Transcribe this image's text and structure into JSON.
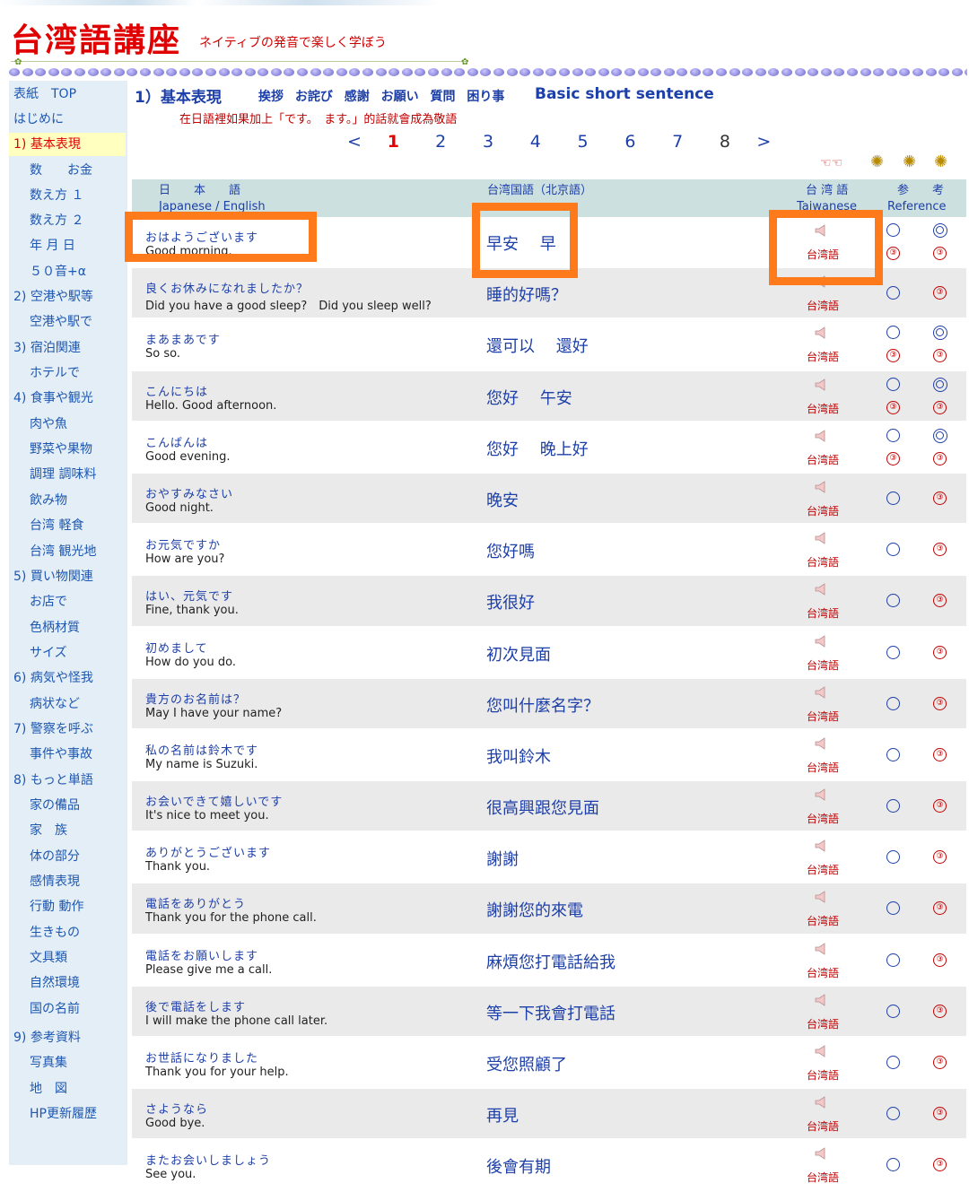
{
  "header": {
    "site_title": "台湾語講座",
    "subtitle": "ネイティブの発音で楽しく学ぼう"
  },
  "sidebar": {
    "items": [
      {
        "label": "表紙　TOP",
        "level": 0
      },
      {
        "label": "はじめに",
        "level": 0
      },
      {
        "label": "1) 基本表現",
        "level": 0,
        "active": true
      },
      {
        "label": "数　　お金",
        "level": 1
      },
      {
        "label": "数え方 １",
        "level": 1
      },
      {
        "label": "数え方 ２",
        "level": 1
      },
      {
        "label": "年 月 日",
        "level": 1
      },
      {
        "label": "５０音+α",
        "level": 1
      },
      {
        "label": "2) 空港や駅等",
        "level": 0
      },
      {
        "label": "空港や駅で",
        "level": 1
      },
      {
        "label": "3) 宿泊関連",
        "level": 0
      },
      {
        "label": "ホテルで",
        "level": 1
      },
      {
        "label": "4) 食事や観光",
        "level": 0
      },
      {
        "label": "肉や魚",
        "level": 1
      },
      {
        "label": "野菜や果物",
        "level": 1
      },
      {
        "label": "調理 調味料",
        "level": 1
      },
      {
        "label": "飲み物",
        "level": 1
      },
      {
        "label": "台湾 軽食",
        "level": 1
      },
      {
        "label": "台湾 観光地",
        "level": 1
      },
      {
        "label": "5) 買い物関連",
        "level": 0
      },
      {
        "label": "お店で",
        "level": 1
      },
      {
        "label": "色柄材質",
        "level": 1
      },
      {
        "label": "サイズ",
        "level": 1
      },
      {
        "label": "6) 病気や怪我",
        "level": 0
      },
      {
        "label": "病状など",
        "level": 1
      },
      {
        "label": "7) 警察を呼ぶ",
        "level": 0
      },
      {
        "label": "事件や事故",
        "level": 1
      },
      {
        "label": "8) もっと単語",
        "level": 0
      },
      {
        "label": "家の備品",
        "level": 1
      },
      {
        "label": "家　族",
        "level": 1
      },
      {
        "label": "体の部分",
        "level": 1
      },
      {
        "label": "感情表現",
        "level": 1
      },
      {
        "label": "行動 動作",
        "level": 1
      },
      {
        "label": "生きもの",
        "level": 1
      },
      {
        "label": "文具類",
        "level": 1
      },
      {
        "label": "自然環境",
        "level": 1
      },
      {
        "label": "国の名前",
        "level": 1
      },
      {
        "label": "9) 参考資料",
        "level": 0
      },
      {
        "label": "写真集",
        "level": 1
      },
      {
        "label": "地　図",
        "level": 1
      },
      {
        "label": "HP更新履歴",
        "level": 1
      }
    ]
  },
  "section": {
    "title": "1）基本表現",
    "tags": "挨拶 お詫び 感謝 お願い 質問 困り事",
    "english": "Basic short sentence",
    "note": "在日語裡如果加上「です。　ます。」的話就會成為敬語"
  },
  "pager": {
    "prev": "<",
    "pages": [
      "1",
      "2",
      "3",
      "4",
      "5",
      "6",
      "7",
      "8"
    ],
    "current": "1",
    "next": ">"
  },
  "table": {
    "headers": {
      "japanese": "日　　本　　語",
      "japanese_sub": "Japanese / English",
      "mandarin": "台湾国語（北京語）",
      "taiwanese": "台 湾 語",
      "taiwanese_sub": "Taiwanese",
      "reference": "参　　考",
      "reference_sub": "Reference"
    },
    "taiwanese_label": "台湾語",
    "ref_number": "③",
    "rows": [
      {
        "ja": "おはようございます",
        "en": "Good morning.",
        "tw": "早安　 早",
        "extra": true
      },
      {
        "ja": "良くお休みになれましたか？",
        "en": "Did you have a good sleep?　Did you sleep well?",
        "tw": "睡的好嗎？",
        "extra": false
      },
      {
        "ja": "まあまあです",
        "en": "So so.",
        "tw": "還可以　 還好",
        "extra": true
      },
      {
        "ja": "こんにちは",
        "en": "Hello. Good afternoon.",
        "tw": "您好　 午安",
        "extra": true
      },
      {
        "ja": "こんばんは",
        "en": "Good evening.",
        "tw": "您好　 晚上好",
        "extra": true
      },
      {
        "ja": "おやすみなさい",
        "en": "Good night.",
        "tw": "晚安",
        "extra": false
      },
      {
        "ja": "お元気ですか",
        "en": "How are you?",
        "tw": "您好嗎",
        "extra": false
      },
      {
        "ja": "はい、元気です",
        "en": "Fine, thank you.",
        "tw": "我很好",
        "extra": false
      },
      {
        "ja": "初めまして",
        "en": "How do you do.",
        "tw": "初次見面",
        "extra": false
      },
      {
        "ja": "貴方のお名前は？",
        "en": "May I have your name?",
        "tw": "您叫什麼名字？",
        "extra": false
      },
      {
        "ja": "私の名前は鈴木です",
        "en": "My name is Suzuki.",
        "tw": "我叫鈴木",
        "extra": false
      },
      {
        "ja": "お会いできて嬉しいです",
        "en": "It's nice to meet you.",
        "tw": "很高興跟您見面",
        "extra": false
      },
      {
        "ja": "ありがとうございます",
        "en": "Thank you.",
        "tw": "謝謝",
        "extra": false
      },
      {
        "ja": "電話をありがとう",
        "en": "Thank you for the phone call.",
        "tw": "謝謝您的來電",
        "extra": false
      },
      {
        "ja": "電話をお願いします",
        "en": "Please give me a call.",
        "tw": "麻煩您打電話給我",
        "extra": false
      },
      {
        "ja": "後で電話をします",
        "en": "I will make the phone call later.",
        "tw": "等一下我會打電話",
        "extra": false
      },
      {
        "ja": "お世話になりました",
        "en": "Thank you for your help.",
        "tw": "受您照顧了",
        "extra": false
      },
      {
        "ja": "さようなら",
        "en": "Good bye.",
        "tw": "再見",
        "extra": false
      },
      {
        "ja": "またお会いしましょう",
        "en": "See you.",
        "tw": "後會有期",
        "extra": false
      }
    ]
  },
  "colors": {
    "accent_red": "#e00000",
    "link_blue": "#1d3fa8",
    "highlight_orange": "#ff7a1a",
    "sidebar_bg": "#e4eef6",
    "header_row_bg": "#cde0e0"
  }
}
